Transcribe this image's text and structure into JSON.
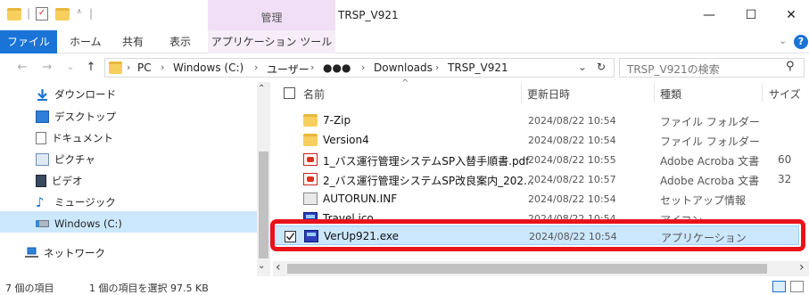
{
  "window": {
    "title": "TRSP_V921",
    "context_tab": "管理",
    "minimize": "—",
    "maximize": "☐",
    "close": "✕"
  },
  "ribbon": {
    "file": "ファイル",
    "home": "ホーム",
    "share": "共有",
    "view": "表示",
    "app_tools": "アプリケーション ツール",
    "chevron": "⌄",
    "help": "?"
  },
  "address": {
    "back": "←",
    "forward": "→",
    "dropdown": "⌄",
    "up": "↑",
    "crumbs": [
      "PC",
      "Windows (C:)",
      "ユーザー",
      "●●●",
      "Downloads",
      "TRSP_V921"
    ],
    "separator": "›",
    "history": "⌄",
    "refresh": "↻",
    "search_placeholder": "TRSP_V921の検索",
    "search_icon": "⚲"
  },
  "nav": {
    "items": [
      {
        "label": "ダウンロード",
        "icon": "download-icon"
      },
      {
        "label": "デスクトップ",
        "icon": "desktop-icon"
      },
      {
        "label": "ドキュメント",
        "icon": "document-icon"
      },
      {
        "label": "ピクチャ",
        "icon": "picture-icon"
      },
      {
        "label": "ビデオ",
        "icon": "video-icon"
      },
      {
        "label": "ミュージック",
        "icon": "music-icon"
      },
      {
        "label": "Windows (C:)",
        "icon": "drive-icon"
      },
      {
        "label": "ネットワーク",
        "icon": "network-icon"
      }
    ],
    "scroll_up": "⌃",
    "scroll_down": "⌄"
  },
  "columns": {
    "name": "名前",
    "date": "更新日時",
    "type": "種類",
    "size": "サイズ",
    "sort_indicator": "^"
  },
  "files": [
    {
      "name": "7-Zip",
      "date": "2024/08/22 10:54",
      "type": "ファイル フォルダー",
      "size": "",
      "icon": "folder-icon"
    },
    {
      "name": "Version4",
      "date": "2024/08/22 10:54",
      "type": "ファイル フォルダー",
      "size": "",
      "icon": "folder-icon"
    },
    {
      "name": "1_バス運行管理システムSP入替手順書.pdf",
      "date": "2024/08/22 10:55",
      "type": "Adobe Acroba 文書",
      "size": "60",
      "icon": "pdf-icon"
    },
    {
      "name": "2_バス運行管理システムSP改良案内_202...",
      "date": "2024/08/22 10:57",
      "type": "Adobe Acroba 文書",
      "size": "32",
      "icon": "pdf-icon"
    },
    {
      "name": "AUTORUN.INF",
      "date": "2024/08/22 10:54",
      "type": "セットアップ情報",
      "size": "",
      "icon": "setup-info-icon"
    },
    {
      "name": "Travel.ico",
      "date": "2024/08/22 10:54",
      "type": "アイコン",
      "size": "",
      "icon": "ico-file-icon"
    },
    {
      "name": "VerUp921.exe",
      "date": "2024/08/22 10:54",
      "type": "アプリケーション",
      "size": "",
      "icon": "exe-icon"
    }
  ],
  "scroll": {
    "left": "‹",
    "right": "›"
  },
  "status": {
    "count": "7 個の項目",
    "selected": "1 個の項目を選択  97.5 KB"
  },
  "colors": {
    "accent": "#1a73d6",
    "selection": "#cce8ff",
    "highlight_border": "#e8141b",
    "context_tab": "#f1dff7"
  }
}
